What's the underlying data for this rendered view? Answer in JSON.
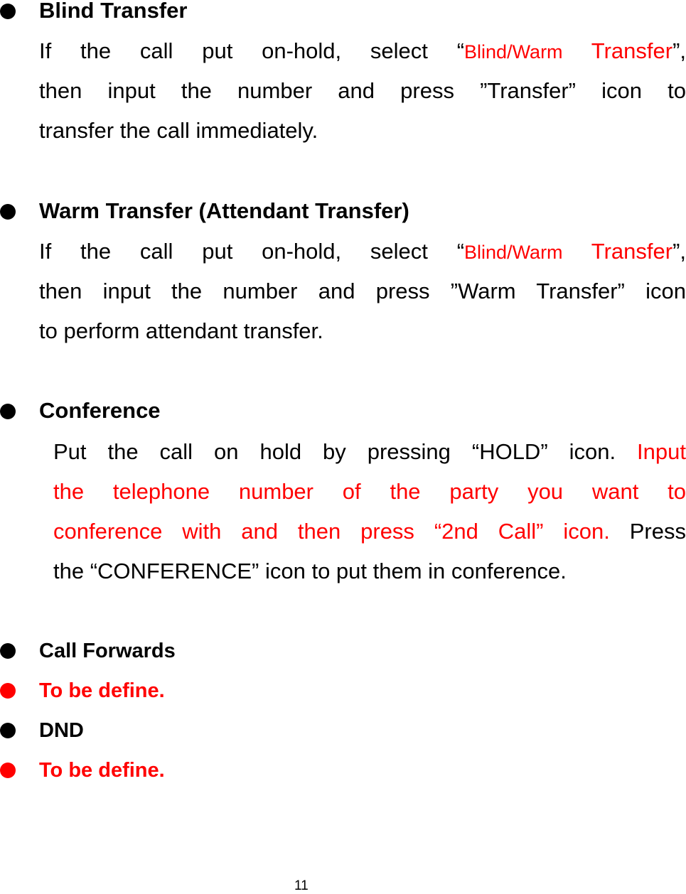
{
  "sections": [
    {
      "heading": "Blind Transfer",
      "lines": [
        {
          "pre": "If the call put on-hold, select “",
          "red_small": "Blind/Warm",
          "red": " Transfer",
          "post": "”,"
        },
        {
          "text": "then input the number and press ”Transfer” icon to"
        },
        {
          "text": "transfer the call immediately."
        }
      ]
    },
    {
      "heading": "Warm Transfer (Attendant Transfer)",
      "lines": [
        {
          "pre": "If the call put on-hold, select “",
          "red_small": "Blind/Warm",
          "red": " Transfer",
          "post": "”,"
        },
        {
          "text": "then input the number and press ”Warm Transfer” icon"
        },
        {
          "text": "to perform attendant transfer."
        }
      ]
    },
    {
      "heading": "Conference",
      "lines": [
        {
          "pre": "Put the call on hold by pressing “HOLD” icon. ",
          "red": "Input"
        },
        {
          "red": "the telephone number of the party you want to"
        },
        {
          "red": "conference with and then press “2nd Call” icon.",
          "post": " Press"
        },
        {
          "text": "the “CONFERENCE” icon to put them in conference."
        }
      ]
    }
  ],
  "list_items": [
    {
      "label": "Call Forwards",
      "color": "#000000"
    },
    {
      "label": "To be define.",
      "color": "#ff0000"
    },
    {
      "label": "DND",
      "color": "#000000"
    },
    {
      "label": "To be define.",
      "color": "#ff0000"
    }
  ],
  "page_number": "11",
  "colors": {
    "text": "#000000",
    "highlight": "#ff0000"
  }
}
